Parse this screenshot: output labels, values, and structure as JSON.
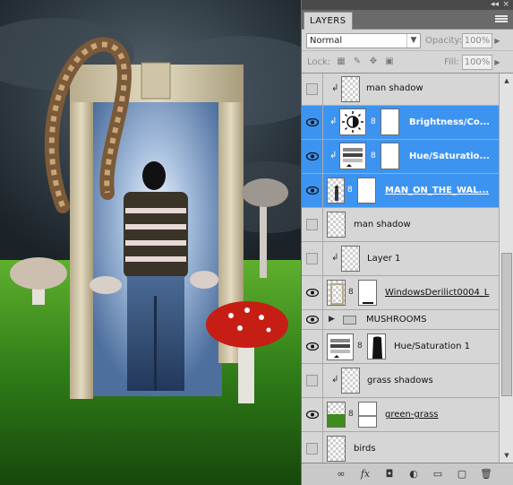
{
  "panel": {
    "tab_label": "LAYERS",
    "collapse_glyph": "◂◂",
    "close_glyph": "×",
    "blend_mode": "Normal",
    "opacity_label": "Opacity:",
    "opacity_value": "100%",
    "lock_label": "Lock:",
    "fill_label": "Fill:",
    "fill_value": "100%"
  },
  "layers": [
    {
      "name": "man shadow",
      "visible": false,
      "clipped": true,
      "selected": false,
      "kind": "pixel"
    },
    {
      "name": "Brightness/Co...",
      "visible": true,
      "clipped": true,
      "selected": true,
      "kind": "adj-brightness"
    },
    {
      "name": "Hue/Saturatio...",
      "visible": true,
      "clipped": true,
      "selected": true,
      "kind": "adj-hue"
    },
    {
      "name": "MAN_ON_THE_WAL...",
      "visible": true,
      "clipped": false,
      "selected": true,
      "kind": "masked-man"
    },
    {
      "name": "man shadow",
      "visible": false,
      "clipped": false,
      "selected": false,
      "kind": "pixel"
    },
    {
      "name": "Layer 1",
      "visible": false,
      "clipped": true,
      "selected": false,
      "kind": "pixel"
    },
    {
      "name": "WindowsDerilict0004_L",
      "visible": true,
      "clipped": false,
      "selected": false,
      "kind": "masked-door"
    },
    {
      "name": "MUSHROOMS",
      "visible": true,
      "clipped": false,
      "selected": false,
      "kind": "group"
    },
    {
      "name": "Hue/Saturation 1",
      "visible": true,
      "clipped": false,
      "selected": false,
      "kind": "adj-hue-mask"
    },
    {
      "name": "grass shadows",
      "visible": false,
      "clipped": true,
      "selected": false,
      "kind": "pixel"
    },
    {
      "name": "green-grass",
      "visible": true,
      "clipped": false,
      "selected": false,
      "kind": "masked-grass"
    },
    {
      "name": "birds",
      "visible": false,
      "clipped": false,
      "selected": false,
      "kind": "pixel"
    }
  ],
  "icons": {
    "clip": "↲",
    "chain": "8",
    "group_arrow": "▶",
    "footer": [
      "link-layers-icon",
      "fx-icon",
      "add-mask-icon",
      "adjustment-icon",
      "group-icon",
      "new-layer-icon",
      "trash-icon"
    ]
  },
  "footer_glyphs": [
    "∞",
    "fx",
    "◘",
    "◐",
    "▭",
    "▢",
    "🗑"
  ],
  "colors": {
    "selection": "#3d94f0",
    "panel_bg": "#d6d6d6"
  }
}
